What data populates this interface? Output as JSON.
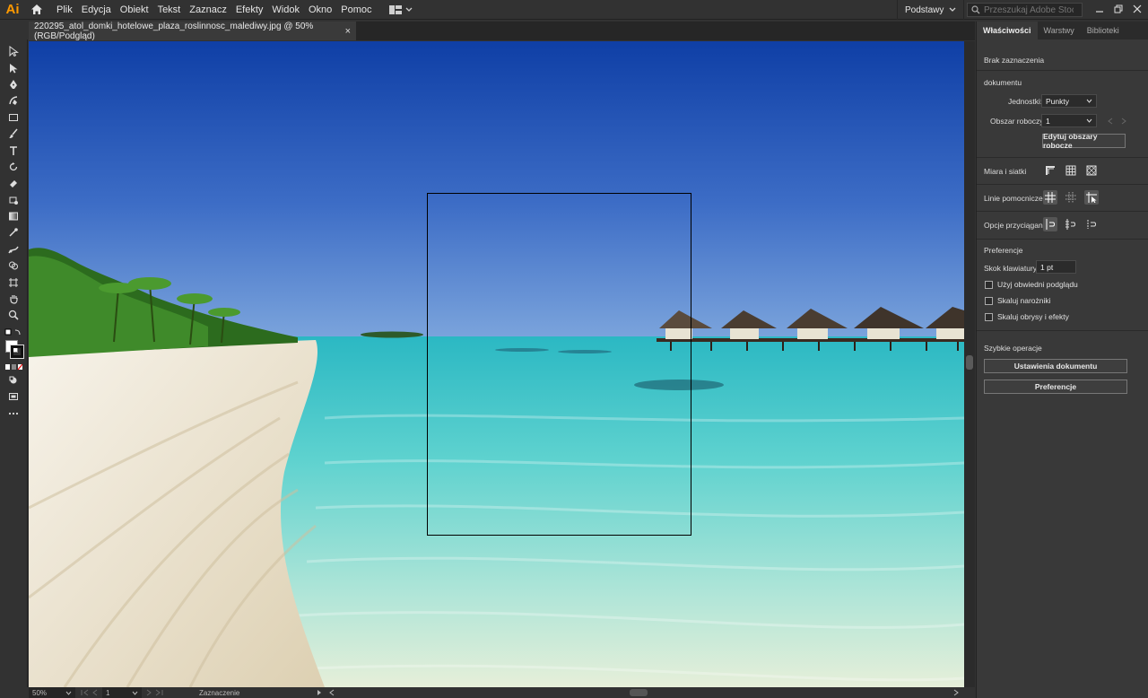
{
  "app": {
    "logo": "Ai"
  },
  "menu": [
    "Plik",
    "Edycja",
    "Obiekt",
    "Tekst",
    "Zaznacz",
    "Efekty",
    "Widok",
    "Okno",
    "Pomoc"
  ],
  "workspace": {
    "label": "Podstawy"
  },
  "search": {
    "placeholder": "Przeszukaj Adobe Stock"
  },
  "document_tab": {
    "title": "220295_atol_domki_hotelowe_plaza_roslinnosc_malediwy.jpg @ 50% (RGB/Podgląd)",
    "close": "×"
  },
  "status_bar": {
    "zoom": "50%",
    "page": "1",
    "info": "Zaznaczenie"
  },
  "panel": {
    "tabs": [
      "Właściwości",
      "Warstwy",
      "Biblioteki"
    ],
    "no_selection": "Brak zaznaczenia",
    "document_section": "dokumentu",
    "units_label": "Jednostki:",
    "units_value": "Punkty",
    "artboard_label": "Obszar roboczy:",
    "artboard_value": "1",
    "edit_artboards": "Edytuj obszary robocze",
    "rulers_grids": "Miara i siatki",
    "guides": "Linie pomocnicze",
    "snap_options": "Opcje przyciągania",
    "preferences_section": "Preferencje",
    "keyboard_increment_label": "Skok klawiatury:",
    "keyboard_increment_value": "1 pt",
    "checkboxes": [
      "Użyj obwiedni podglądu",
      "Skaluj narożniki",
      "Skaluj obrysy i efekty"
    ],
    "quick_actions": "Szybkie operacje",
    "doc_settings_btn": "Ustawienia dokumentu",
    "preferences_btn": "Preferencje"
  },
  "colors": {
    "accent_logo": "#ff9a00",
    "panel_bg": "#393939",
    "ui_bg": "#323232"
  }
}
